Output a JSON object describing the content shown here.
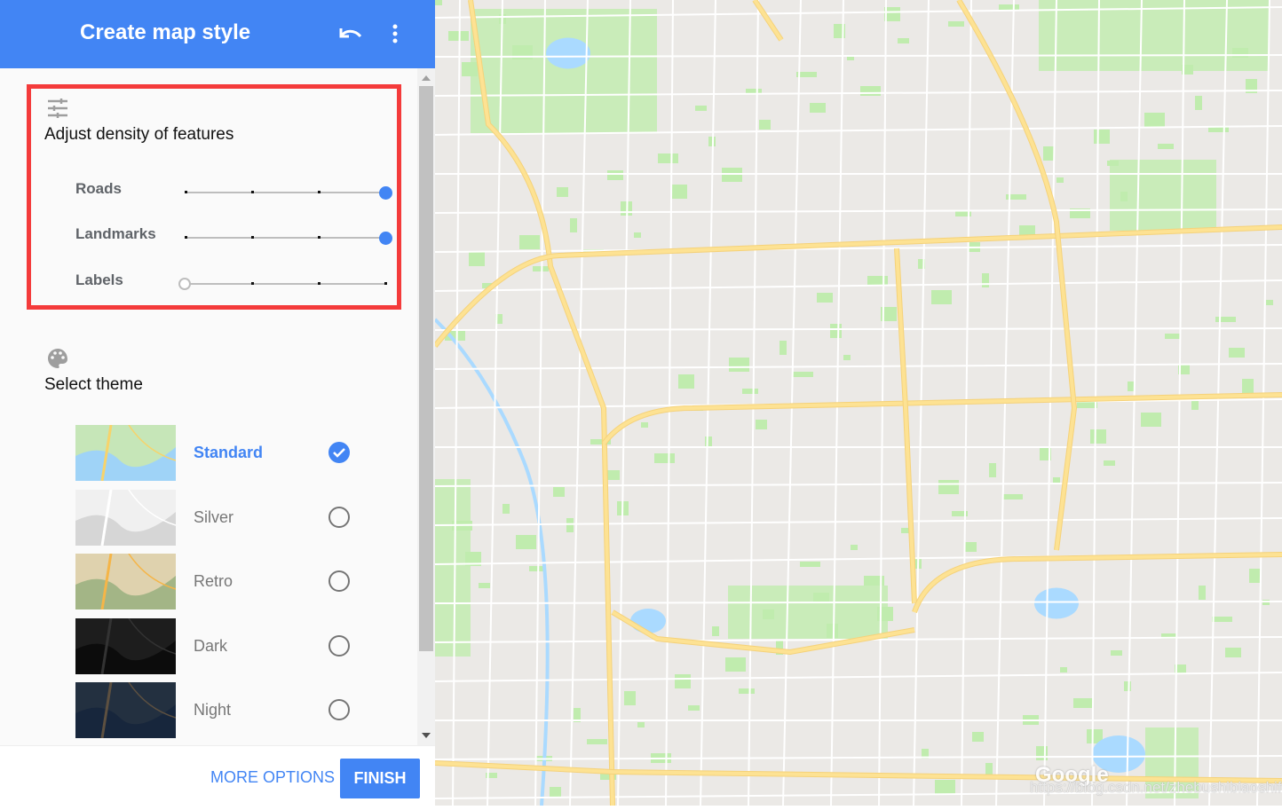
{
  "header": {
    "title": "Create map style",
    "undo_icon": "undo-icon",
    "more_icon": "more-vert-icon"
  },
  "colors": {
    "accent": "#4285f4",
    "highlight_border": "#f43b3b",
    "road_major": "#fde293",
    "park": "#c0ecae",
    "water": "#aadaff",
    "map_bg": "#ebe9e6"
  },
  "density": {
    "icon": "tune-icon",
    "title": "Adjust density of features",
    "sliders": [
      {
        "label": "Roads",
        "level": 3,
        "max": 3
      },
      {
        "label": "Landmarks",
        "level": 3,
        "max": 3
      },
      {
        "label": "Labels",
        "level": 0,
        "max": 3
      }
    ]
  },
  "theme": {
    "icon": "palette-icon",
    "title": "Select theme",
    "options": [
      {
        "label": "Standard",
        "selected": true
      },
      {
        "label": "Silver",
        "selected": false
      },
      {
        "label": "Retro",
        "selected": false
      },
      {
        "label": "Dark",
        "selected": false
      },
      {
        "label": "Night",
        "selected": false
      }
    ]
  },
  "footer": {
    "more_options": "MORE OPTIONS",
    "finish": "FINISH"
  },
  "map": {
    "logo": "Google",
    "watermark": "https://blog.csdn.net/zhebushibiaoshifu"
  }
}
